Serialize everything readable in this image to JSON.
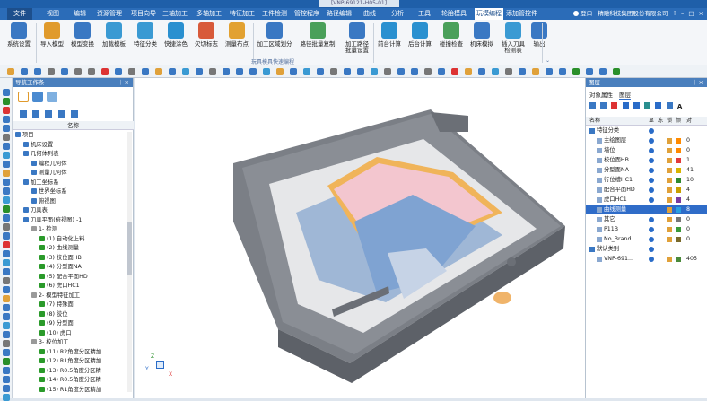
{
  "title_bar": {
    "document": "[VNP-69121-H05-01]"
  },
  "menu": {
    "file": "文件",
    "items": [
      "视图",
      "编辑",
      "资源管理",
      "项目向导",
      "三轴加工",
      "多轴加工",
      "特征加工",
      "工件检测",
      "管控程序",
      "路径编辑",
      "曲线",
      "分析",
      "工具",
      "轮胎模具",
      "玩模编程",
      "添加管控件"
    ],
    "active_index": 14,
    "right": {
      "login": "登口",
      "company": "精雕科技集团股份有限公司"
    }
  },
  "ribbon": {
    "buttons": [
      {
        "label": "系统设置",
        "color": "#3a78c3"
      },
      {
        "label": "导入模型",
        "color": "#e09a2c"
      },
      {
        "label": "模型变换",
        "color": "#3a78c3"
      },
      {
        "label": "加载模板",
        "color": "#3a9ad3"
      },
      {
        "label": "特征分类",
        "color": "#3a9ad3"
      },
      {
        "label": "快捷涂色",
        "color": "#2a90d0"
      },
      {
        "label": "欠切标志",
        "color": "#d85a3a"
      },
      {
        "label": "测量布点",
        "color": "#e2a131"
      },
      {
        "label": "加工区域划分",
        "color": "#3a78c3"
      },
      {
        "label": "路径批量复制",
        "color": "#4aa05a"
      },
      {
        "label": "加工路径\n批量设置",
        "color": "#3a78c3"
      },
      {
        "label": "前台计算",
        "color": "#2a90d0"
      },
      {
        "label": "后台计算",
        "color": "#2a90d0"
      },
      {
        "label": "碰撞检查",
        "color": "#4aa05a"
      },
      {
        "label": "机床模拟",
        "color": "#3a78c3"
      },
      {
        "label": "插入刀具\n检测表",
        "color": "#3a9ad3"
      },
      {
        "label": "输出",
        "color": "#3a78c3"
      }
    ],
    "group_label": "玩具模具快速编程"
  },
  "nav_panel": {
    "title": "导航工作条",
    "column": "名称",
    "tree": [
      {
        "text": "项目",
        "indent": 0
      },
      {
        "text": "机床设置",
        "indent": 1
      },
      {
        "text": "几何体列表",
        "indent": 1
      },
      {
        "text": "编程几何体",
        "indent": 2
      },
      {
        "text": "测量几何体",
        "indent": 2
      },
      {
        "text": "加工坐标系",
        "indent": 1
      },
      {
        "text": "世界坐标系",
        "indent": 2
      },
      {
        "text": "俯视图",
        "indent": 2
      },
      {
        "text": "刀具表",
        "indent": 1
      },
      {
        "text": "刀具平面(俯视图) -1",
        "indent": 1
      },
      {
        "text": "1- 检测",
        "indent": 2
      },
      {
        "text": "(1) 自动化上料",
        "indent": 3
      },
      {
        "text": "(2) 曲线测量",
        "indent": 3
      },
      {
        "text": "(3) 校位面HB",
        "indent": 3
      },
      {
        "text": "(4) 分型面NA",
        "indent": 3
      },
      {
        "text": "(5) 配合平面HD",
        "indent": 3
      },
      {
        "text": "(6) 虎口HC1",
        "indent": 3
      },
      {
        "text": "2- 模型特征加工",
        "indent": 2
      },
      {
        "text": "(7) 特殊面",
        "indent": 3
      },
      {
        "text": "(8) 胶位",
        "indent": 3
      },
      {
        "text": "(9) 分型面",
        "indent": 3
      },
      {
        "text": "(10) 虎口",
        "indent": 3
      },
      {
        "text": "3- 校位加工",
        "indent": 2
      },
      {
        "text": "(11) R2角度分区精加",
        "indent": 3
      },
      {
        "text": "(12) R1角度分区精加",
        "indent": 3
      },
      {
        "text": "(13) R0.5角度分区精",
        "indent": 3
      },
      {
        "text": "(14) R0.5角度分区精",
        "indent": 3
      },
      {
        "text": "(15) R1角度分区精加",
        "indent": 3
      }
    ]
  },
  "right_panel": {
    "title": "图层",
    "tabs": [
      "对象属性",
      "图层"
    ],
    "columns": [
      "名称",
      "显",
      "冻",
      "锁",
      "颜",
      "对"
    ],
    "rows": [
      {
        "name": "特征分类",
        "indent": 0,
        "count": ""
      },
      {
        "name": "主绘图层",
        "indent": 1,
        "count": "0",
        "color": "#ff8a00"
      },
      {
        "name": "墙位",
        "indent": 1,
        "count": "0",
        "color": "#ff8a00"
      },
      {
        "name": "校位面HB",
        "indent": 1,
        "count": "1",
        "color": "#e23a3a"
      },
      {
        "name": "分型面NA",
        "indent": 1,
        "count": "41",
        "color": "#d9b400"
      },
      {
        "name": "行位槽HC1",
        "indent": 1,
        "count": "10",
        "color": "#2f8a2f"
      },
      {
        "name": "配合平面HD",
        "indent": 1,
        "count": "4",
        "color": "#c9a000"
      },
      {
        "name": "虎口HC1",
        "indent": 1,
        "count": "4",
        "color": "#7a3aa0"
      },
      {
        "name": "曲线测量",
        "indent": 1,
        "count": "8",
        "color": "#2aa0e0",
        "selected": true
      },
      {
        "name": "其它",
        "indent": 1,
        "count": "0",
        "color": "#777777"
      },
      {
        "name": "P11B",
        "indent": 1,
        "count": "0",
        "color": "#3a9a3a"
      },
      {
        "name": "No_Brand",
        "indent": 1,
        "count": "0",
        "color": "#7a6a2a"
      },
      {
        "name": "默认类别",
        "indent": 0,
        "count": ""
      },
      {
        "name": "VNP-691...",
        "indent": 1,
        "count": "405",
        "color": "#4a8a3a"
      }
    ]
  },
  "viewport": {
    "axis_labels": {
      "x": "X",
      "y": "Y",
      "z": "Z"
    }
  }
}
